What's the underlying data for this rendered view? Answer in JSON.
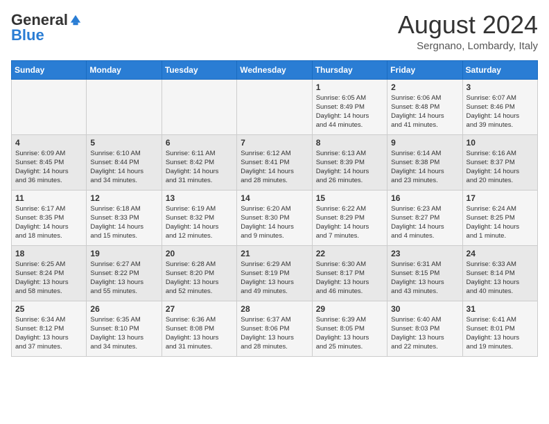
{
  "header": {
    "logo_general": "General",
    "logo_blue": "Blue",
    "month_year": "August 2024",
    "location": "Sergnano, Lombardy, Italy"
  },
  "calendar": {
    "days_of_week": [
      "Sunday",
      "Monday",
      "Tuesday",
      "Wednesday",
      "Thursday",
      "Friday",
      "Saturday"
    ],
    "weeks": [
      [
        {
          "day": "",
          "info": ""
        },
        {
          "day": "",
          "info": ""
        },
        {
          "day": "",
          "info": ""
        },
        {
          "day": "",
          "info": ""
        },
        {
          "day": "1",
          "info": "Sunrise: 6:05 AM\nSunset: 8:49 PM\nDaylight: 14 hours\nand 44 minutes."
        },
        {
          "day": "2",
          "info": "Sunrise: 6:06 AM\nSunset: 8:48 PM\nDaylight: 14 hours\nand 41 minutes."
        },
        {
          "day": "3",
          "info": "Sunrise: 6:07 AM\nSunset: 8:46 PM\nDaylight: 14 hours\nand 39 minutes."
        }
      ],
      [
        {
          "day": "4",
          "info": "Sunrise: 6:09 AM\nSunset: 8:45 PM\nDaylight: 14 hours\nand 36 minutes."
        },
        {
          "day": "5",
          "info": "Sunrise: 6:10 AM\nSunset: 8:44 PM\nDaylight: 14 hours\nand 34 minutes."
        },
        {
          "day": "6",
          "info": "Sunrise: 6:11 AM\nSunset: 8:42 PM\nDaylight: 14 hours\nand 31 minutes."
        },
        {
          "day": "7",
          "info": "Sunrise: 6:12 AM\nSunset: 8:41 PM\nDaylight: 14 hours\nand 28 minutes."
        },
        {
          "day": "8",
          "info": "Sunrise: 6:13 AM\nSunset: 8:39 PM\nDaylight: 14 hours\nand 26 minutes."
        },
        {
          "day": "9",
          "info": "Sunrise: 6:14 AM\nSunset: 8:38 PM\nDaylight: 14 hours\nand 23 minutes."
        },
        {
          "day": "10",
          "info": "Sunrise: 6:16 AM\nSunset: 8:37 PM\nDaylight: 14 hours\nand 20 minutes."
        }
      ],
      [
        {
          "day": "11",
          "info": "Sunrise: 6:17 AM\nSunset: 8:35 PM\nDaylight: 14 hours\nand 18 minutes."
        },
        {
          "day": "12",
          "info": "Sunrise: 6:18 AM\nSunset: 8:33 PM\nDaylight: 14 hours\nand 15 minutes."
        },
        {
          "day": "13",
          "info": "Sunrise: 6:19 AM\nSunset: 8:32 PM\nDaylight: 14 hours\nand 12 minutes."
        },
        {
          "day": "14",
          "info": "Sunrise: 6:20 AM\nSunset: 8:30 PM\nDaylight: 14 hours\nand 9 minutes."
        },
        {
          "day": "15",
          "info": "Sunrise: 6:22 AM\nSunset: 8:29 PM\nDaylight: 14 hours\nand 7 minutes."
        },
        {
          "day": "16",
          "info": "Sunrise: 6:23 AM\nSunset: 8:27 PM\nDaylight: 14 hours\nand 4 minutes."
        },
        {
          "day": "17",
          "info": "Sunrise: 6:24 AM\nSunset: 8:25 PM\nDaylight: 14 hours\nand 1 minute."
        }
      ],
      [
        {
          "day": "18",
          "info": "Sunrise: 6:25 AM\nSunset: 8:24 PM\nDaylight: 13 hours\nand 58 minutes."
        },
        {
          "day": "19",
          "info": "Sunrise: 6:27 AM\nSunset: 8:22 PM\nDaylight: 13 hours\nand 55 minutes."
        },
        {
          "day": "20",
          "info": "Sunrise: 6:28 AM\nSunset: 8:20 PM\nDaylight: 13 hours\nand 52 minutes."
        },
        {
          "day": "21",
          "info": "Sunrise: 6:29 AM\nSunset: 8:19 PM\nDaylight: 13 hours\nand 49 minutes."
        },
        {
          "day": "22",
          "info": "Sunrise: 6:30 AM\nSunset: 8:17 PM\nDaylight: 13 hours\nand 46 minutes."
        },
        {
          "day": "23",
          "info": "Sunrise: 6:31 AM\nSunset: 8:15 PM\nDaylight: 13 hours\nand 43 minutes."
        },
        {
          "day": "24",
          "info": "Sunrise: 6:33 AM\nSunset: 8:14 PM\nDaylight: 13 hours\nand 40 minutes."
        }
      ],
      [
        {
          "day": "25",
          "info": "Sunrise: 6:34 AM\nSunset: 8:12 PM\nDaylight: 13 hours\nand 37 minutes."
        },
        {
          "day": "26",
          "info": "Sunrise: 6:35 AM\nSunset: 8:10 PM\nDaylight: 13 hours\nand 34 minutes."
        },
        {
          "day": "27",
          "info": "Sunrise: 6:36 AM\nSunset: 8:08 PM\nDaylight: 13 hours\nand 31 minutes."
        },
        {
          "day": "28",
          "info": "Sunrise: 6:37 AM\nSunset: 8:06 PM\nDaylight: 13 hours\nand 28 minutes."
        },
        {
          "day": "29",
          "info": "Sunrise: 6:39 AM\nSunset: 8:05 PM\nDaylight: 13 hours\nand 25 minutes."
        },
        {
          "day": "30",
          "info": "Sunrise: 6:40 AM\nSunset: 8:03 PM\nDaylight: 13 hours\nand 22 minutes."
        },
        {
          "day": "31",
          "info": "Sunrise: 6:41 AM\nSunset: 8:01 PM\nDaylight: 13 hours\nand 19 minutes."
        }
      ]
    ]
  }
}
